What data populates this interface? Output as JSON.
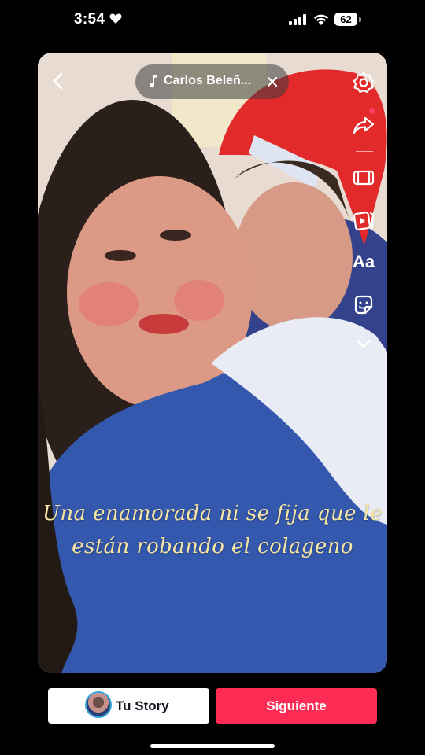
{
  "status_bar": {
    "time": "3:54",
    "battery": "62"
  },
  "music": {
    "title": "Carlos Beleñ..."
  },
  "caption": {
    "line1": "Una enamorada ni se fija que le",
    "line2": "están robando el colageno"
  },
  "tools": [
    "settings-icon",
    "share-icon",
    "clip-icon",
    "video-icon",
    "text-icon",
    "sticker-icon",
    "chevron-down-icon"
  ],
  "text_tool": {
    "label": "Aa"
  },
  "bottom": {
    "story_label": "Tu Story",
    "next_label": "Siguiente"
  },
  "colors": {
    "accent": "#fe2c55",
    "caption": "#f7e6a3",
    "notif_dot": "#ff3b5c"
  }
}
